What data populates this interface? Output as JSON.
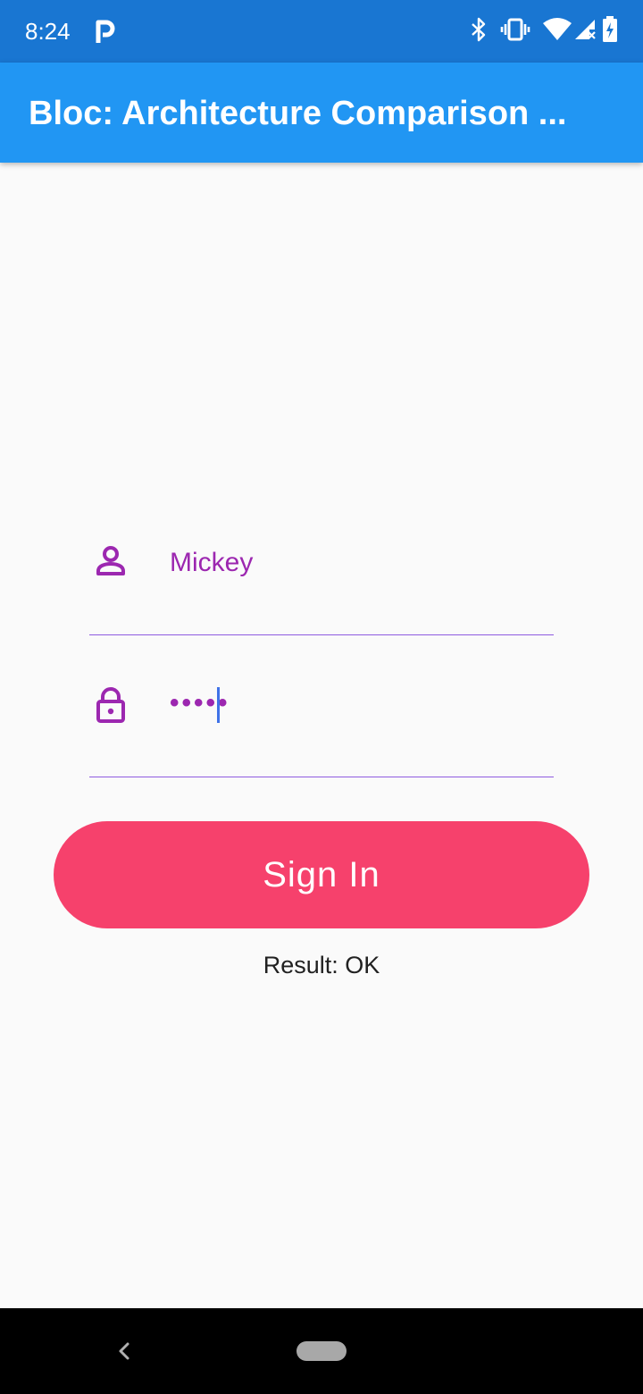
{
  "status_bar": {
    "time": "8:24",
    "icons": [
      "parking-icon",
      "bluetooth-icon",
      "vibrate-icon",
      "wifi-icon",
      "signal-icon",
      "battery-charging-icon"
    ],
    "color": "#1976d2"
  },
  "app_bar": {
    "title": "Bloc: Architecture Comparison ...",
    "color": "#2196f3"
  },
  "form": {
    "username": {
      "icon": "person-icon",
      "value": "Mickey"
    },
    "password": {
      "icon": "lock-icon",
      "value": "•••••"
    },
    "accent_color": "#9c27b0",
    "underline_color": "#8e5be0"
  },
  "sign_in_button": {
    "label": "Sign In",
    "color": "#f6416c"
  },
  "result": {
    "text": "Result: OK"
  },
  "nav_bar": {
    "icons": [
      "back-icon",
      "home-pill-icon"
    ]
  }
}
